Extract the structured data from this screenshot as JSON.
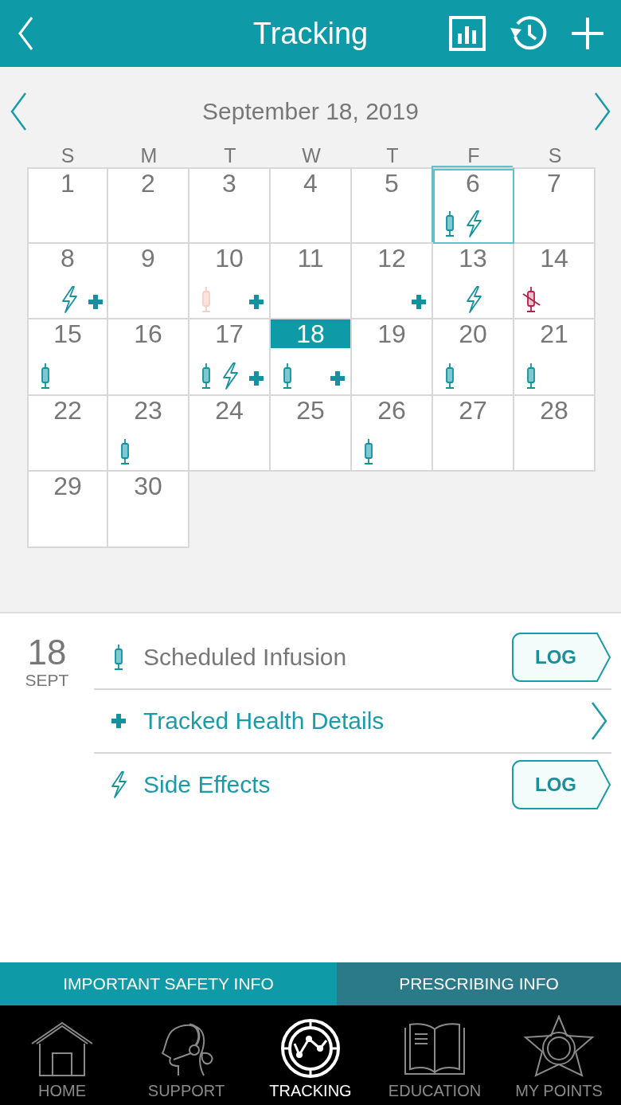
{
  "header": {
    "title": "Tracking"
  },
  "calendar": {
    "month_title": "September 18, 2019",
    "weekdays": [
      "S",
      "M",
      "T",
      "W",
      "T",
      "F",
      "S"
    ],
    "days": [
      {
        "day": "1",
        "selected": false,
        "today": false
      },
      {
        "day": "2",
        "selected": false,
        "today": false
      },
      {
        "day": "3",
        "selected": false,
        "today": false
      },
      {
        "day": "4",
        "selected": false,
        "today": false
      },
      {
        "day": "5",
        "selected": false,
        "today": false
      },
      {
        "day": "6",
        "selected": false,
        "today": true,
        "marks": [
          {
            "kind": "infusion"
          },
          {
            "kind": "side_effect"
          }
        ]
      },
      {
        "day": "7",
        "selected": false,
        "today": false
      },
      {
        "day": "8",
        "selected": false,
        "today": false,
        "marks": [
          {
            "kind": "side_effect"
          },
          {
            "kind": "health"
          }
        ]
      },
      {
        "day": "9",
        "selected": false,
        "today": false
      },
      {
        "day": "10",
        "selected": false,
        "today": false,
        "marks": [
          {
            "kind": "missed"
          },
          {
            "kind": "health"
          }
        ]
      },
      {
        "day": "11",
        "selected": false,
        "today": false
      },
      {
        "day": "12",
        "selected": false,
        "today": false,
        "marks": [
          {
            "kind": "health"
          }
        ]
      },
      {
        "day": "13",
        "selected": false,
        "today": false,
        "marks": [
          {
            "kind": "side_effect"
          }
        ]
      },
      {
        "day": "14",
        "selected": false,
        "today": false,
        "marks": [
          {
            "kind": "skipped"
          }
        ]
      },
      {
        "day": "15",
        "selected": false,
        "today": false,
        "marks": [
          {
            "kind": "infusion"
          }
        ]
      },
      {
        "day": "16",
        "selected": false,
        "today": false
      },
      {
        "day": "17",
        "selected": false,
        "today": false,
        "marks": [
          {
            "kind": "infusion"
          },
          {
            "kind": "side_effect"
          },
          {
            "kind": "health"
          }
        ]
      },
      {
        "day": "18",
        "selected": true,
        "today": false,
        "marks": [
          {
            "kind": "infusion"
          },
          {
            "kind": "health"
          }
        ]
      },
      {
        "day": "19",
        "selected": false,
        "today": false
      },
      {
        "day": "20",
        "selected": false,
        "today": false,
        "marks": [
          {
            "kind": "infusion"
          }
        ]
      },
      {
        "day": "21",
        "selected": false,
        "today": false,
        "marks": [
          {
            "kind": "infusion"
          }
        ]
      },
      {
        "day": "22",
        "selected": false,
        "today": false
      },
      {
        "day": "23",
        "selected": false,
        "today": false,
        "marks": [
          {
            "kind": "infusion"
          }
        ]
      },
      {
        "day": "24",
        "selected": false,
        "today": false
      },
      {
        "day": "25",
        "selected": false,
        "today": false
      },
      {
        "day": "26",
        "selected": false,
        "today": false,
        "marks": [
          {
            "kind": "infusion"
          }
        ]
      },
      {
        "day": "27",
        "selected": false,
        "today": false
      },
      {
        "day": "28",
        "selected": false,
        "today": false
      },
      {
        "day": "29",
        "selected": false,
        "today": false
      },
      {
        "day": "30",
        "selected": false,
        "today": false
      }
    ]
  },
  "detail": {
    "day": "18",
    "month": "SEPT",
    "rows": [
      {
        "kind": "infusion",
        "label": "Scheduled Infusion",
        "action": "LOG"
      },
      {
        "kind": "health",
        "label": "Tracked Health Details"
      },
      {
        "kind": "side_effect",
        "label": "Side Effects",
        "action": "LOG"
      }
    ]
  },
  "info_bar": [
    {
      "label": "IMPORTANT SAFETY INFO"
    },
    {
      "label": "PRESCRIBING INFO"
    }
  ],
  "nav": [
    {
      "kind": "home",
      "label": "HOME",
      "selected": false
    },
    {
      "kind": "support",
      "label": "SUPPORT",
      "selected": false
    },
    {
      "kind": "tracking",
      "label": "TRACKING",
      "selected": true
    },
    {
      "kind": "education",
      "label": "EDUCATION",
      "selected": false
    },
    {
      "kind": "points",
      "label": "MY POINTS",
      "selected": false
    }
  ]
}
